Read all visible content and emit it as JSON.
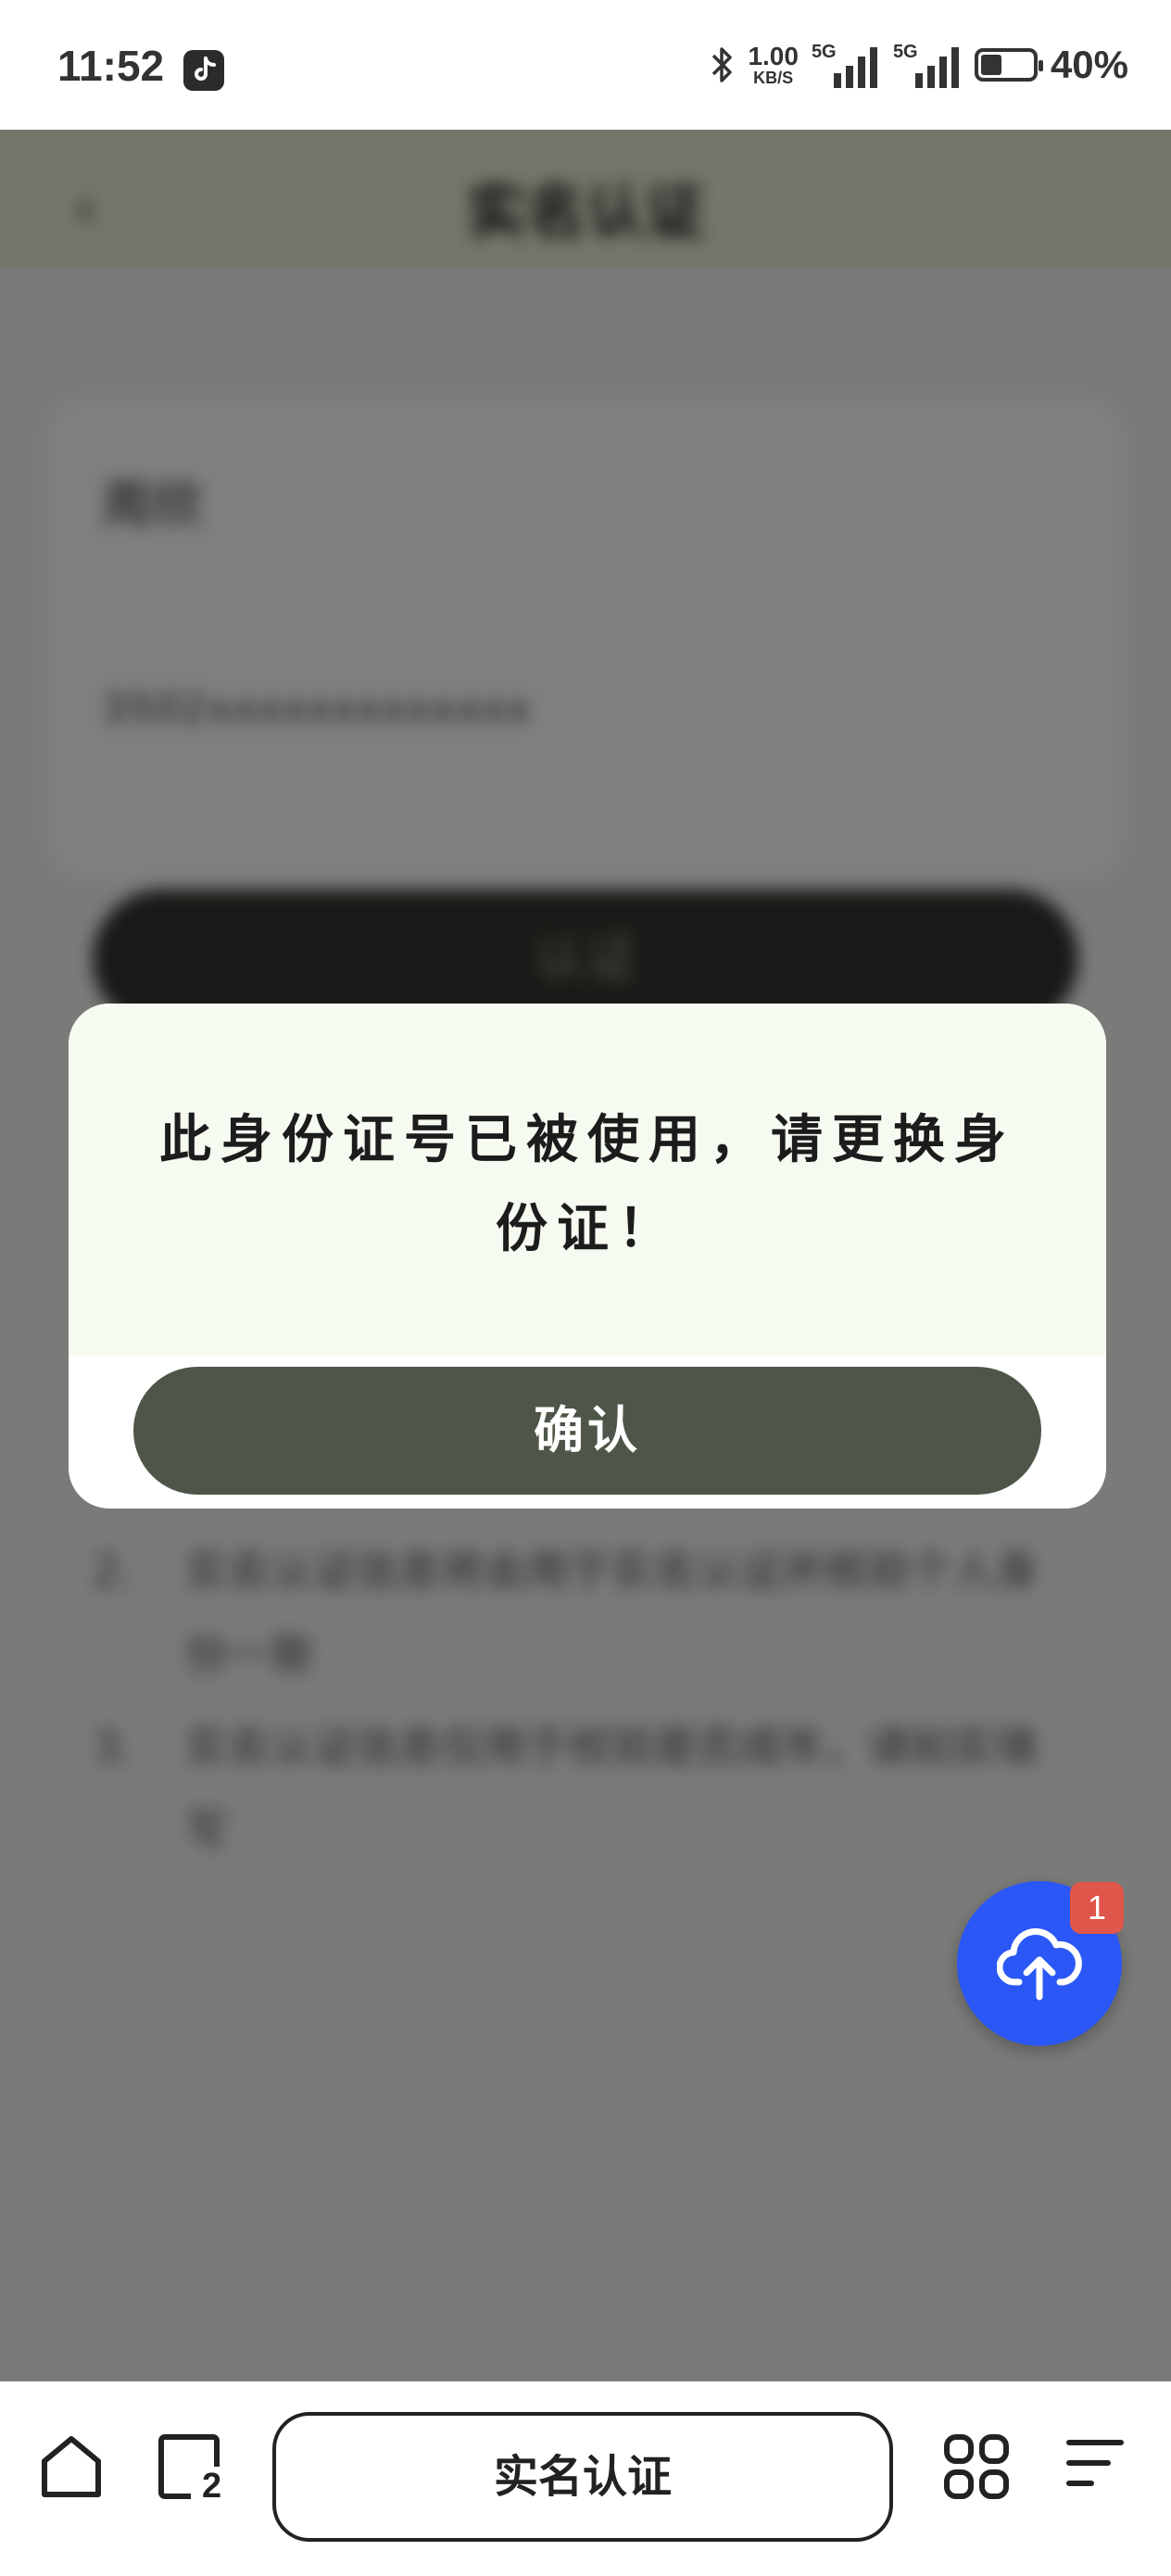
{
  "status_bar": {
    "time": "11:52",
    "app_icon": "tiktok-icon",
    "bluetooth_icon": "bluetooth-icon",
    "speed_value": "1.00",
    "speed_unit": "KB/S",
    "network_1": "5G",
    "network_2": "5G",
    "battery_level_percent": 40,
    "battery_text": "40%"
  },
  "underlying_page": {
    "back_icon": "chevron-left-icon",
    "title": "实名认证",
    "name_value": "周欣",
    "id_value": "3502xxxxxxxxxxxxx",
    "submit_label": "认证",
    "notes": [
      {
        "num": "2.",
        "text": "实名认证信息将会用于实名认证并核验个人身份一致"
      },
      {
        "num": "3.",
        "text": "实名认证信息仅用于校验是否成年，请如实填写"
      }
    ]
  },
  "dialog": {
    "message": "此身份证号已被使用，请更换身份证！",
    "confirm_label": "确认"
  },
  "floating_upload": {
    "icon": "cloud-upload-icon",
    "badge_count": "1"
  },
  "bottom_bar": {
    "home_icon": "home-icon",
    "tabs_icon": "tabs-icon",
    "tabs_count": "2",
    "address_text": "实名认证",
    "apps_icon": "grid-icon",
    "menu_icon": "menu-icon"
  }
}
